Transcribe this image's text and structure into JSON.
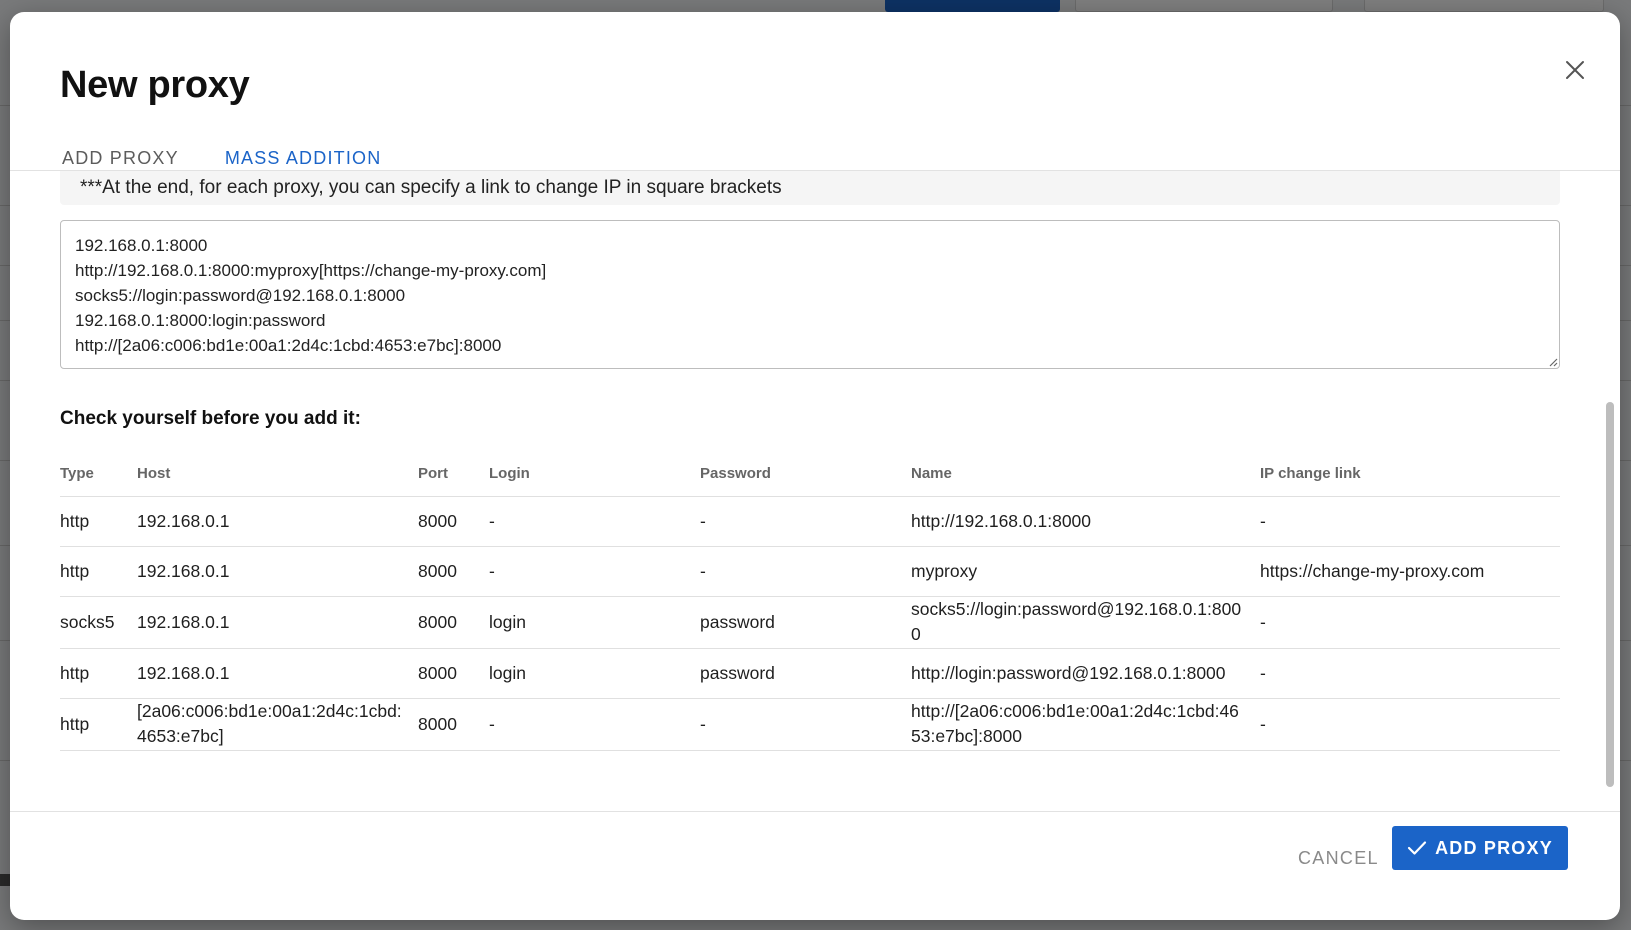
{
  "modal": {
    "title": "New proxy",
    "tabs": [
      {
        "label": "ADD PROXY",
        "active": false
      },
      {
        "label": "MASS ADDITION",
        "active": true
      }
    ],
    "hint": "***At the end, for each proxy, you can specify a link to change IP in square brackets",
    "textarea_lines": [
      "192.168.0.1:8000",
      "http://192.168.0.1:8000:myproxy[https://change-my-proxy.com]",
      "socks5://login:password@192.168.0.1:8000",
      "192.168.0.1:8000:login:password",
      "http://[2a06:c006:bd1e:00a1:2d4c:1cbd:4653:e7bc]:8000"
    ],
    "check_title": "Check yourself before you add it:",
    "table": {
      "headers": [
        "Type",
        "Host",
        "Port",
        "Login",
        "Password",
        "Name",
        "IP change link"
      ],
      "rows": [
        [
          "http",
          "192.168.0.1",
          "8000",
          "-",
          "-",
          "http://192.168.0.1:8000",
          "-"
        ],
        [
          "http",
          "192.168.0.1",
          "8000",
          "-",
          "-",
          "myproxy",
          "https://change-my-proxy.com"
        ],
        [
          "socks5",
          "192.168.0.1",
          "8000",
          "login",
          "password",
          "socks5://login:password@192.168.0.1:8000",
          "-"
        ],
        [
          "http",
          "192.168.0.1",
          "8000",
          "login",
          "password",
          "http://login:password@192.168.0.1:8000",
          "-"
        ],
        [
          "http",
          "[2a06:c006:bd1e:00a1:2d4c:1cbd:4653:e7bc]",
          "8000",
          "-",
          "-",
          "http://[2a06:c006:bd1e:00a1:2d4c:1cbd:4653:e7bc]:8000",
          "-"
        ]
      ]
    },
    "cancel_label": "CANCEL",
    "add_label": "ADD PROXY"
  },
  "colors": {
    "accent": "#1b64c8",
    "overlay": "#7a7a7a"
  },
  "icons": {
    "close": "close-icon",
    "check": "check-icon"
  }
}
